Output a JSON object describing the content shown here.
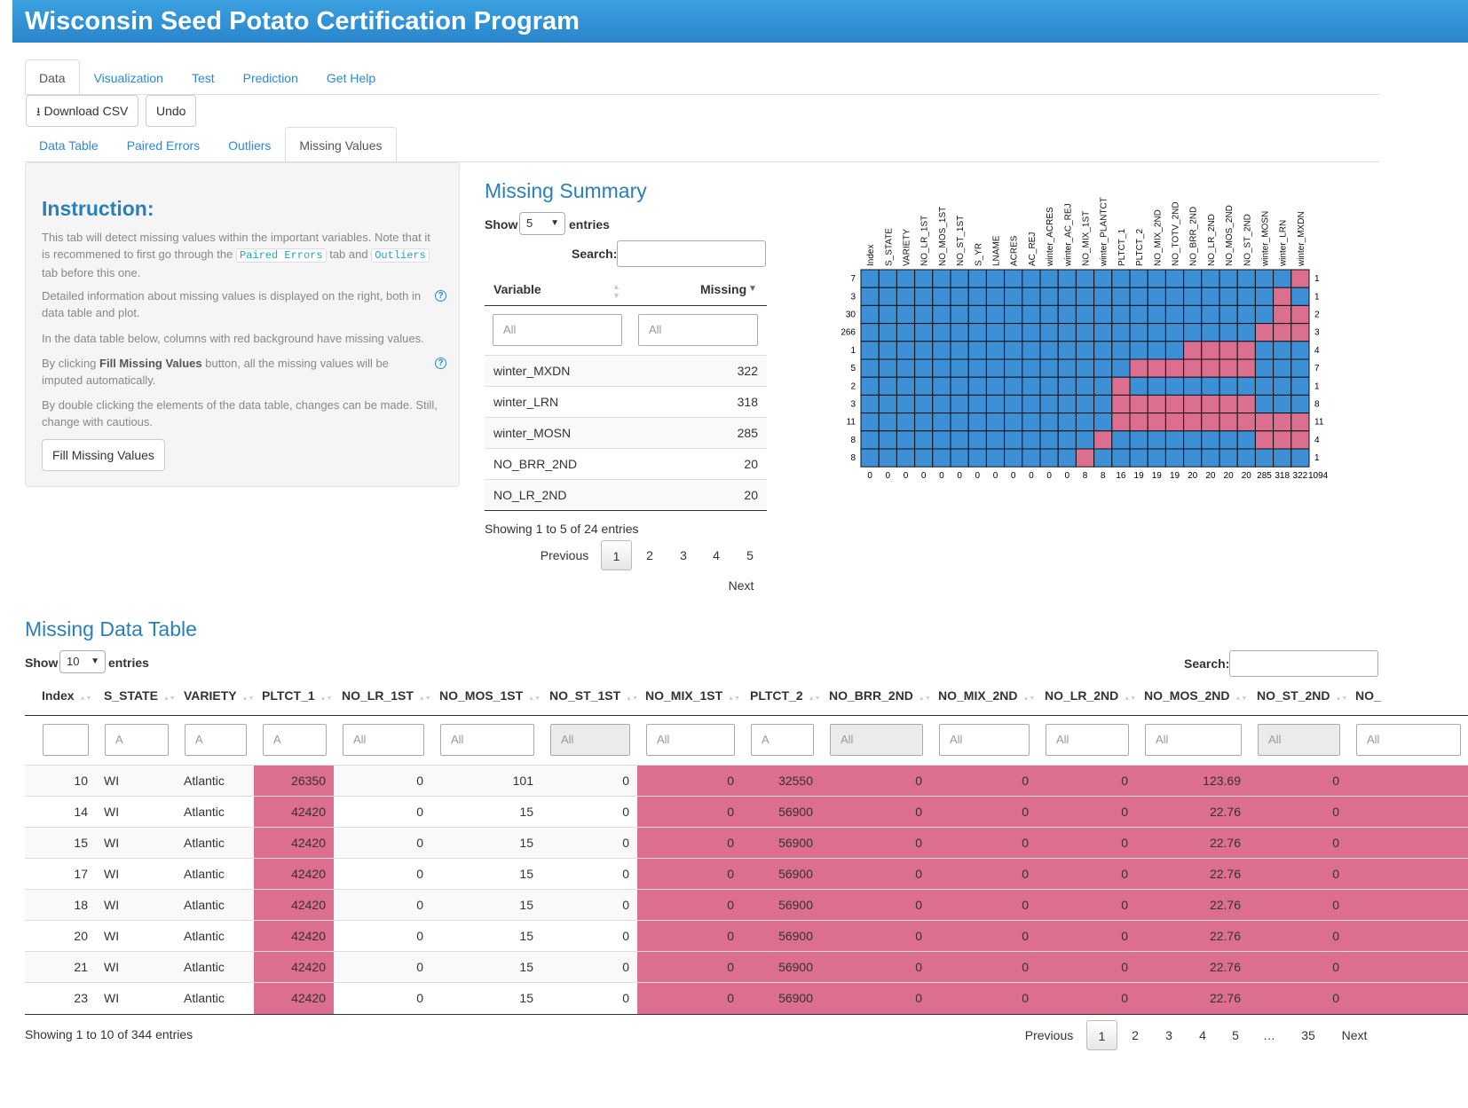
{
  "app": {
    "title": "Wisconsin Seed Potato Certification Program"
  },
  "main_tabs": [
    "Data",
    "Visualization",
    "Test",
    "Prediction",
    "Get Help"
  ],
  "toolbar": {
    "download": "Download CSV",
    "undo": "Undo"
  },
  "sub_tabs": [
    "Data Table",
    "Paired Errors",
    "Outliers",
    "Missing Values"
  ],
  "instruction": {
    "title": "Instruction:",
    "p1a": "This tab will detect missing values within the important variables. Note that it is recommened to first go through the",
    "p1_code1": "Paired Errors",
    "p1b": "tab and",
    "p1_code2": "Outliers",
    "p1c": "tab before this one.",
    "p2": "Detailed information about missing values is displayed on the right, both in data table and plot.",
    "p3": "In the data table below, columns with red background have missing values.",
    "p4a": "By clicking",
    "p4b": "Fill Missing Values",
    "p4c": "button, all the missing values will be imputed automatically.",
    "p5": "By double clicking the elements of the data table, changes can be made. Still, change with cautious.",
    "fill_button": "Fill Missing Values"
  },
  "summary": {
    "title": "Missing Summary",
    "show": "Show",
    "show_value": "5",
    "entries": "entries",
    "search": "Search:",
    "col_variable": "Variable",
    "col_missing": "Missing",
    "filter_placeholder": "All",
    "rows": [
      {
        "variable": "winter_MXDN",
        "missing": "322"
      },
      {
        "variable": "winter_LRN",
        "missing": "318"
      },
      {
        "variable": "winter_MOSN",
        "missing": "285"
      },
      {
        "variable": "NO_BRR_2ND",
        "missing": "20"
      },
      {
        "variable": "NO_LR_2ND",
        "missing": "20"
      }
    ],
    "info": "Showing 1 to 5 of 24 entries",
    "pagination": {
      "prev": "Previous",
      "pages": [
        "1",
        "2",
        "3",
        "4",
        "5"
      ],
      "next": "Next"
    }
  },
  "chart_data": {
    "type": "heatmap",
    "columns": [
      "Index",
      "S_STATE",
      "VARIETY",
      "NO_LR_1ST",
      "NO_MOS_1ST",
      "NO_ST_1ST",
      "S_YR",
      "LNAME",
      "ACRES",
      "AC_REJ",
      "winter_ACRES",
      "winter_AC_REJ",
      "NO_MIX_1ST",
      "winter_PLANTCT",
      "PLTCT_1",
      "PLTCT_2",
      "NO_MIX_2ND",
      "NO_TOTV_2ND",
      "NO_BRR_2ND",
      "NO_LR_2ND",
      "NO_MOS_2ND",
      "NO_ST_2ND",
      "winter_MOSN",
      "winter_LRN",
      "winter_MXDN"
    ],
    "row_counts": [
      "7",
      "3",
      "30",
      "266",
      "1",
      "5",
      "2",
      "3",
      "11",
      "8",
      "8"
    ],
    "row_missing": [
      "1",
      "1",
      "2",
      "3",
      "4",
      "7",
      "1",
      "8",
      "11",
      "4",
      "1"
    ],
    "col_missing": [
      "0",
      "0",
      "0",
      "0",
      "0",
      "0",
      "0",
      "0",
      "0",
      "0",
      "0",
      "0",
      "8",
      "8",
      "16",
      "19",
      "19",
      "19",
      "20",
      "20",
      "20",
      "20",
      "285",
      "318",
      "322",
      "1094"
    ],
    "missing_cells": [
      [
        24
      ],
      [
        23
      ],
      [
        23,
        24
      ],
      [
        22,
        23,
        24
      ],
      [
        18,
        19,
        20,
        21
      ],
      [
        15,
        16,
        17,
        18,
        19,
        20,
        21
      ],
      [
        14
      ],
      [
        14,
        15,
        16,
        17,
        18,
        19,
        20,
        21
      ],
      [
        14,
        15,
        16,
        17,
        18,
        19,
        20,
        21,
        22,
        23,
        24
      ],
      [
        13,
        22,
        23,
        24
      ],
      [
        12
      ]
    ],
    "colors": {
      "present": "#3d8fd6",
      "missing": "#dc6e8f"
    }
  },
  "missing_table": {
    "title": "Missing Data Table",
    "show": "Show",
    "show_value": "10",
    "entries": "entries",
    "search": "Search:",
    "columns": [
      "Index",
      "S_STATE",
      "VARIETY",
      "PLTCT_1",
      "NO_LR_1ST",
      "NO_MOS_1ST",
      "NO_ST_1ST",
      "NO_MIX_1ST",
      "PLTCT_2",
      "NO_BRR_2ND",
      "NO_MIX_2ND",
      "NO_LR_2ND",
      "NO_MOS_2ND",
      "NO_ST_2ND",
      "NO_"
    ],
    "filters": [
      "",
      "A",
      "A",
      "A",
      "All",
      "All",
      "All",
      "All",
      "A",
      "All",
      "All",
      "All",
      "All",
      "All",
      "All"
    ],
    "rows": [
      [
        "10",
        "WI",
        "Atlantic",
        "26350",
        "0",
        "101",
        "0",
        "0",
        "32550",
        "0",
        "0",
        "0",
        "123.69",
        "0"
      ],
      [
        "14",
        "WI",
        "Atlantic",
        "42420",
        "0",
        "15",
        "0",
        "0",
        "56900",
        "0",
        "0",
        "0",
        "22.76",
        "0"
      ],
      [
        "15",
        "WI",
        "Atlantic",
        "42420",
        "0",
        "15",
        "0",
        "0",
        "56900",
        "0",
        "0",
        "0",
        "22.76",
        "0"
      ],
      [
        "17",
        "WI",
        "Atlantic",
        "42420",
        "0",
        "15",
        "0",
        "0",
        "56900",
        "0",
        "0",
        "0",
        "22.76",
        "0"
      ],
      [
        "18",
        "WI",
        "Atlantic",
        "42420",
        "0",
        "15",
        "0",
        "0",
        "56900",
        "0",
        "0",
        "0",
        "22.76",
        "0"
      ],
      [
        "20",
        "WI",
        "Atlantic",
        "42420",
        "0",
        "15",
        "0",
        "0",
        "56900",
        "0",
        "0",
        "0",
        "22.76",
        "0"
      ],
      [
        "21",
        "WI",
        "Atlantic",
        "42420",
        "0",
        "15",
        "0",
        "0",
        "56900",
        "0",
        "0",
        "0",
        "22.76",
        "0"
      ],
      [
        "23",
        "WI",
        "Atlantic",
        "42420",
        "0",
        "15",
        "0",
        "0",
        "56900",
        "0",
        "0",
        "0",
        "22.76",
        "0"
      ]
    ],
    "info": "Showing 1 to 10 of 344 entries",
    "pagination": {
      "prev": "Previous",
      "pages": [
        "1",
        "2",
        "3",
        "4",
        "5",
        "…",
        "35"
      ],
      "next": "Next"
    },
    "highlight_color": "#dc6e8f"
  }
}
